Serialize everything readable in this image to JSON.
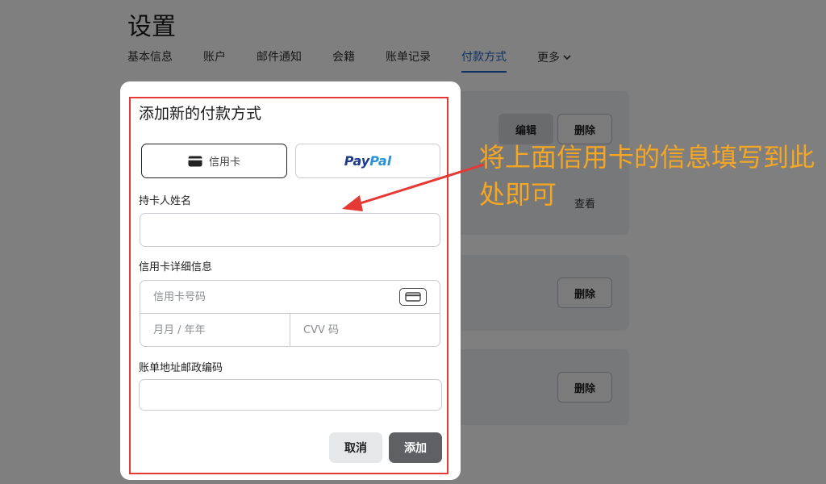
{
  "page": {
    "title": "设置",
    "tabs": [
      {
        "label": "基本信息"
      },
      {
        "label": "账户"
      },
      {
        "label": "邮件通知"
      },
      {
        "label": "会籍"
      },
      {
        "label": "账单记录"
      },
      {
        "label": "付款方式",
        "active": true
      },
      {
        "label": "更多"
      }
    ],
    "cards": [
      {
        "edit_label": "编辑",
        "delete_label": "删除",
        "view_label": "查看"
      },
      {
        "delete_label": "删除"
      },
      {
        "delete_label": "删除"
      }
    ]
  },
  "modal": {
    "title": "添加新的付款方式",
    "method_credit_card": "信用卡",
    "method_paypal_part1": "Pay",
    "method_paypal_part2": "Pal",
    "cardholder_label": "持卡人姓名",
    "cardholder_value": "",
    "card_details_label": "信用卡详细信息",
    "card_number_placeholder": "信用卡号码",
    "expiry_placeholder": "月月 / 年年",
    "cvv_placeholder": "CVV 码",
    "zip_label": "账单地址邮政编码",
    "zip_value": "",
    "cancel_label": "取消",
    "add_label": "添加"
  },
  "annotation": {
    "text": "将上面信用卡的信息填写到此处即可",
    "color": "#f5a623",
    "frame_color": "#e53935"
  }
}
